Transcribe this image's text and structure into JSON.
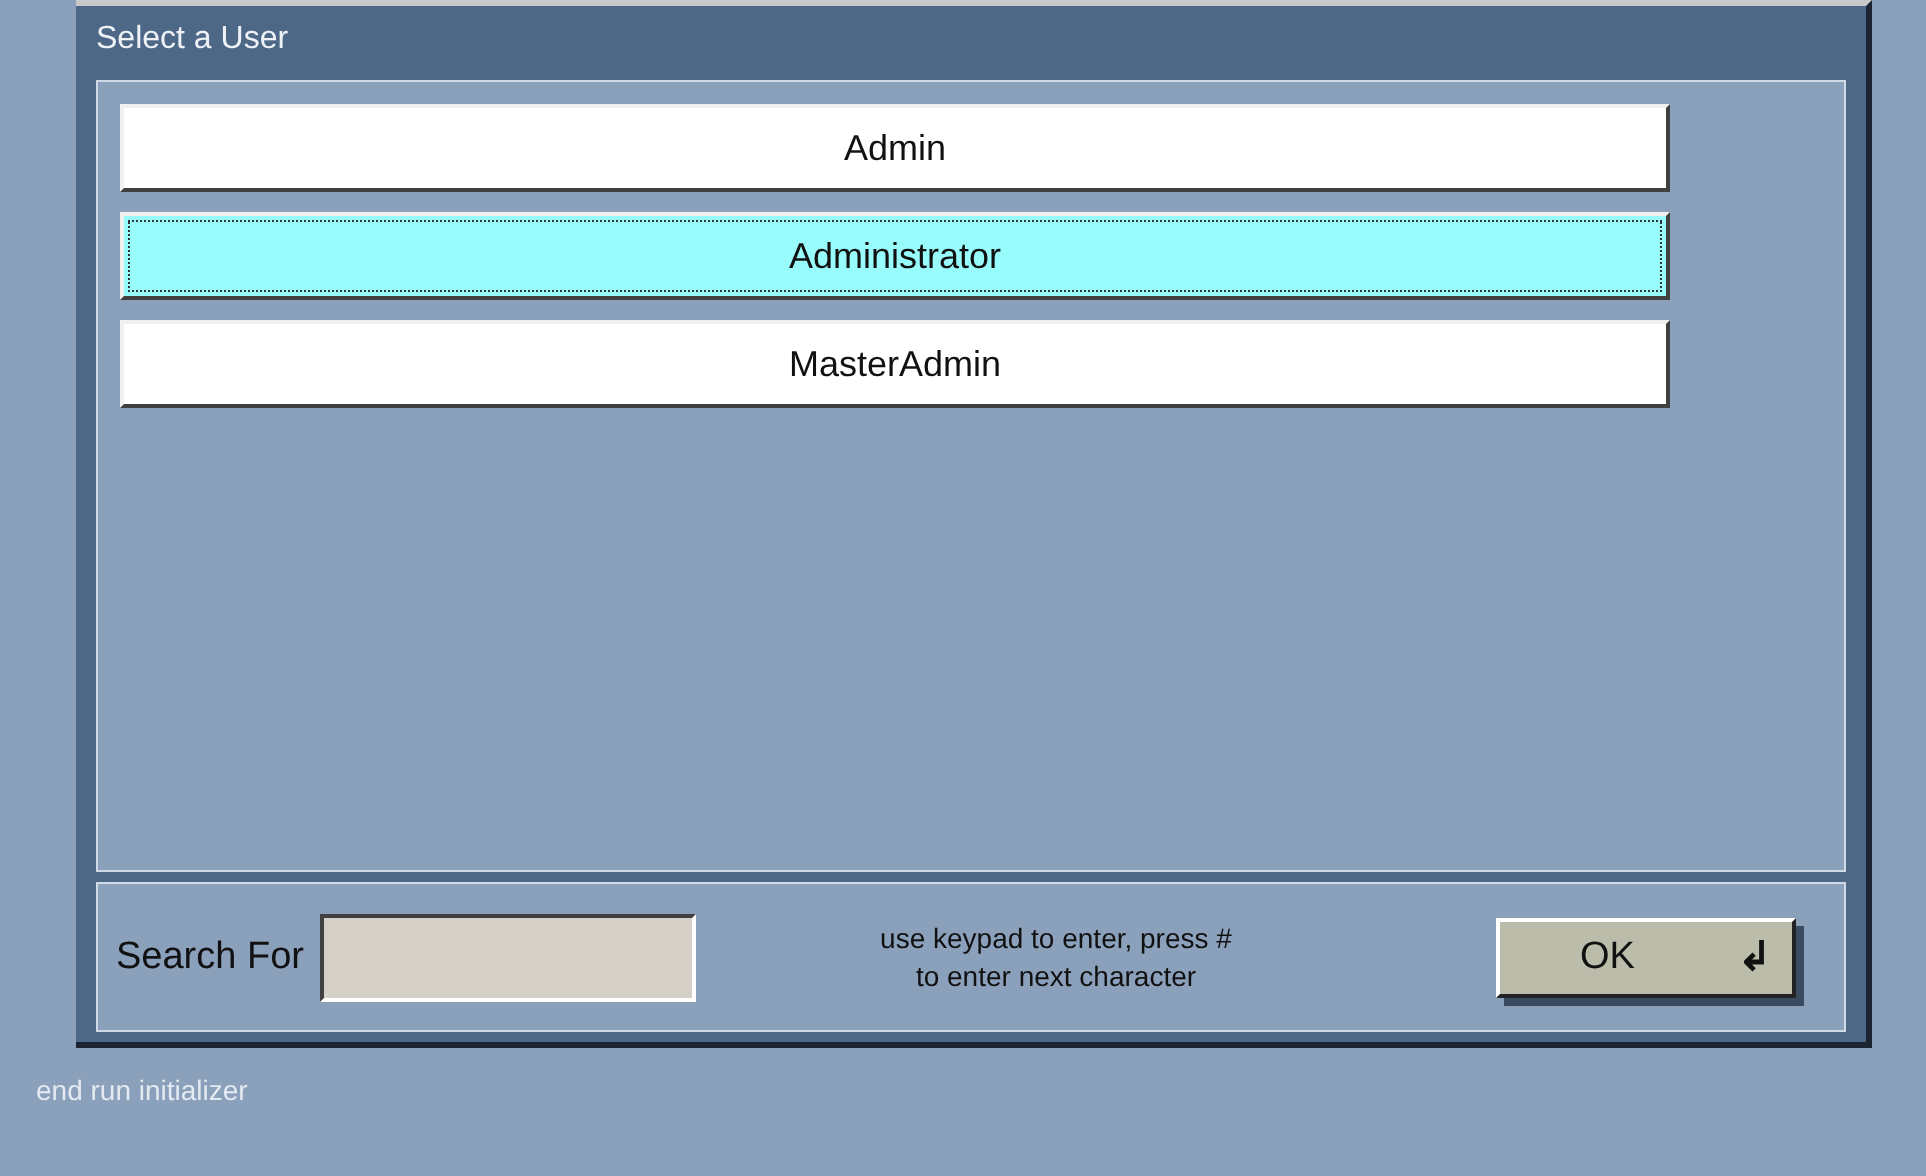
{
  "dialog": {
    "title": "Select a User"
  },
  "users": [
    {
      "label": "Admin",
      "selected": false
    },
    {
      "label": "Administrator",
      "selected": true
    },
    {
      "label": "MasterAdmin",
      "selected": false
    }
  ],
  "search": {
    "label": "Search For",
    "hint": "use keypad to enter, press #\nto enter next character"
  },
  "ok_button": {
    "label": "OK",
    "icon": "↲"
  },
  "status_text": "end run initializer"
}
